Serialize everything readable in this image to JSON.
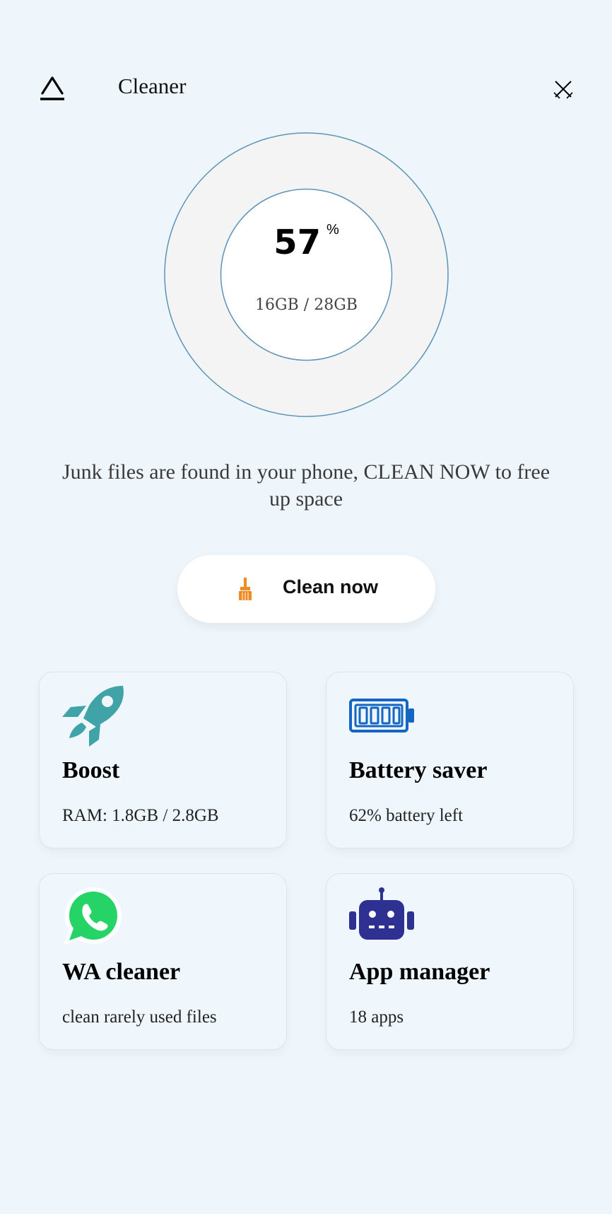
{
  "header": {
    "title": "Cleaner",
    "back_icon": "back-icon",
    "close_icon": "close-icon"
  },
  "storage": {
    "percent": "57",
    "percent_sign": "%",
    "usage": "16GB / 28GB"
  },
  "message": "Junk files are found in your phone, CLEAN NOW to free up space",
  "clean_button": {
    "label": "Clean now",
    "icon": "broom-icon"
  },
  "cards": [
    {
      "title": "Boost",
      "subtitle": "RAM: 1.8GB / 2.8GB",
      "icon": "rocket-icon"
    },
    {
      "title": "Battery saver",
      "subtitle": "62% battery left",
      "icon": "battery-icon"
    },
    {
      "title": "WA cleaner",
      "subtitle": "clean rarely used files",
      "icon": "whatsapp-icon"
    },
    {
      "title": "App manager",
      "subtitle": "18 apps",
      "icon": "robot-icon"
    }
  ],
  "colors": {
    "background": "#eef6fc",
    "ring_stroke": "#5b94b8",
    "ring_fill": "#f4f4f4",
    "broom": "#f08a24",
    "rocket": "#3fa3a8",
    "battery": "#1366c2",
    "whatsapp": "#25d366",
    "robot": "#2e3192"
  }
}
